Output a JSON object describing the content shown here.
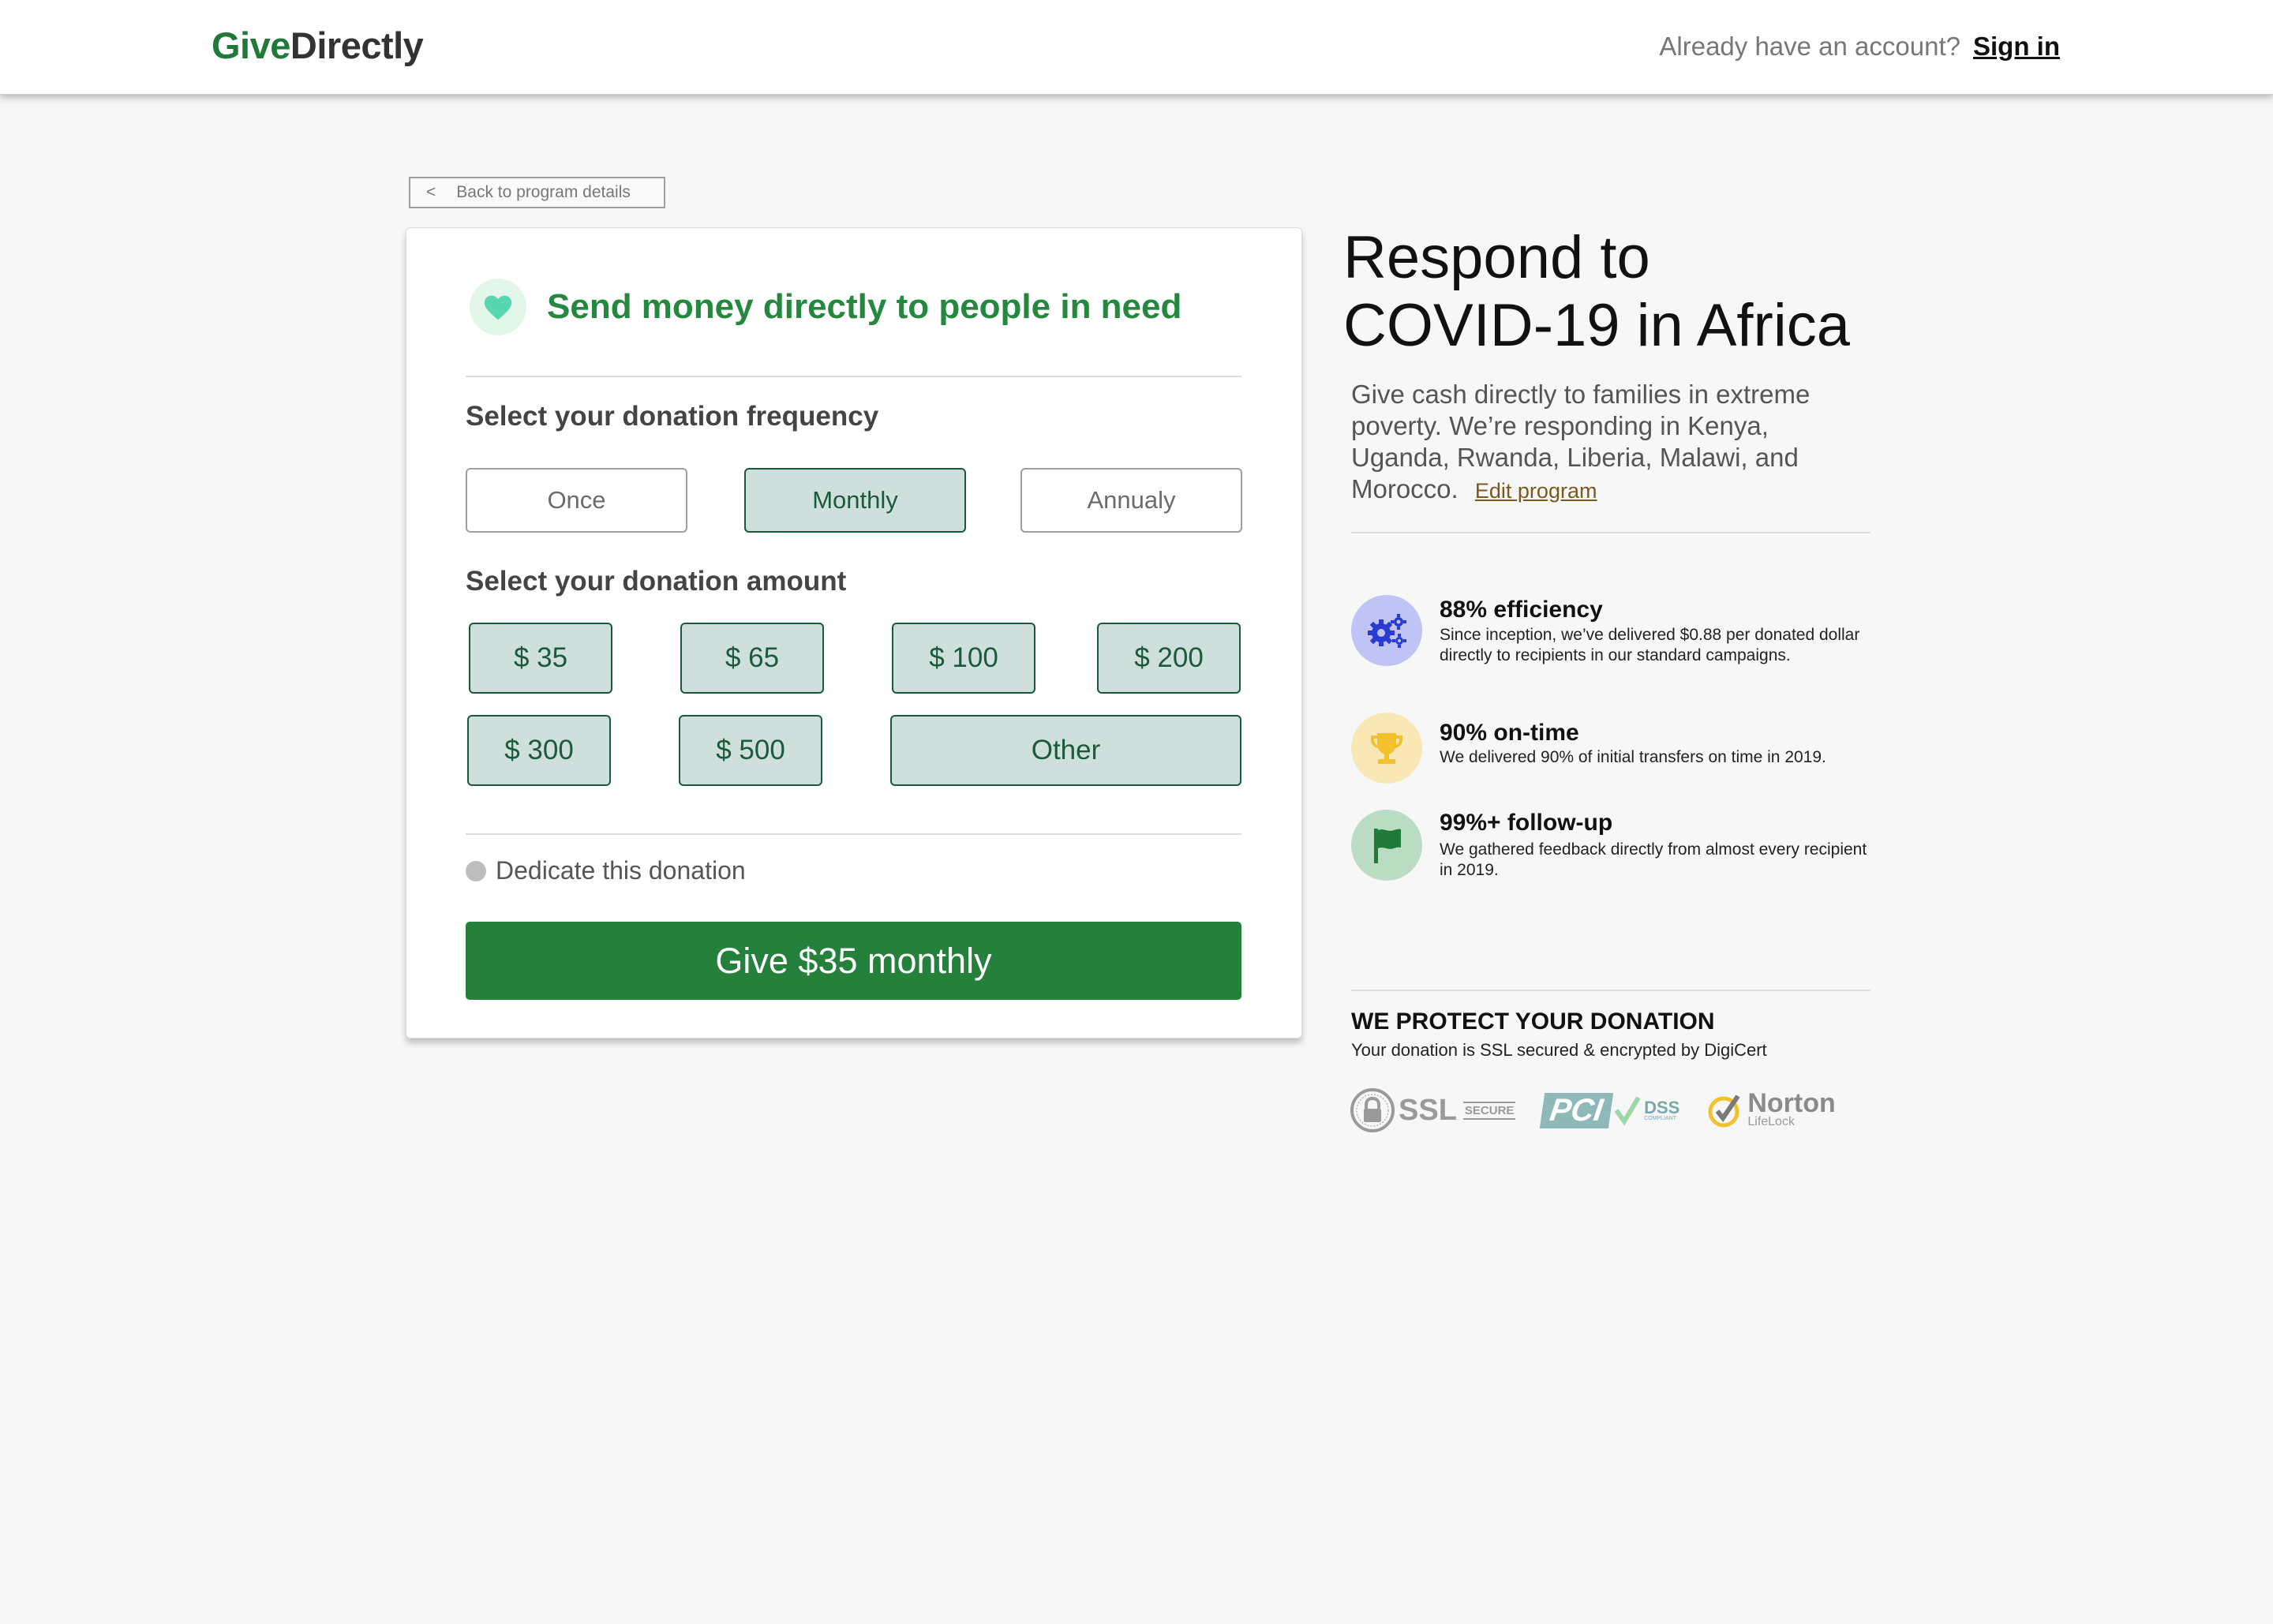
{
  "header": {
    "logo_give": "Give",
    "logo_directly": "Directly",
    "account_prompt": "Already have an account?",
    "signin_label": "Sign in"
  },
  "back": {
    "chevron": "<",
    "label": "Back to program details"
  },
  "form": {
    "title": "Send money directly to people in need",
    "frequency_label": "Select your donation frequency",
    "frequencies": [
      "Once",
      "Monthly",
      "Annualy"
    ],
    "selected_frequency": "Monthly",
    "amount_label": "Select your donation amount",
    "amounts": [
      "$ 35",
      "$ 65",
      "$ 100",
      "$ 200",
      "$ 300",
      "$ 500",
      "Other"
    ],
    "dedicate_label": "Dedicate this donation",
    "submit_label": "Give $35 monthly"
  },
  "program": {
    "title_line1": "Respond to",
    "title_line2": "COVID-19 in Africa",
    "description": "Give cash directly to families in extreme poverty. We’re responding in Kenya, Uganda, Rwanda, Liberia, Malawi, and Morocco.",
    "edit_label": "Edit program"
  },
  "stats": [
    {
      "title": "88% efficiency",
      "text": "Since inception, we’ve delivered $0.88 per donated dollar directly to recipients in our standard campaigns.",
      "icon": "gears-icon",
      "icon_bg": "#bfc3f5",
      "icon_color": "#2a3bd1"
    },
    {
      "title": "90% on-time",
      "text": "We delivered 90% of initial transfers on time in 2019.",
      "icon": "trophy-icon",
      "icon_bg": "#f9e8b5",
      "icon_color": "#f2c12e"
    },
    {
      "title": "99%+ follow-up",
      "text": "We gathered feedback directly from almost every recipient in 2019.",
      "icon": "flag-icon",
      "icon_bg": "#b9dcc2",
      "icon_color": "#1f7a3a"
    }
  ],
  "security": {
    "title": "WE PROTECT YOUR DONATION",
    "text": "Your donation is SSL secured & encrypted by DigiCert",
    "ssl_label": "SSL",
    "ssl_sub": "SECURE",
    "pci_label": "PCI",
    "dss_label": "DSS",
    "dss_sub": "COMPLIANT",
    "norton_label": "Norton",
    "lifelock_label": "LifeLock"
  },
  "colors": {
    "brand_green": "#1f7a3a",
    "button_green": "#24803b",
    "selected_fill": "#cfe0dc",
    "selected_border": "#1a5a3a",
    "link_brown": "#7a5a1c"
  }
}
